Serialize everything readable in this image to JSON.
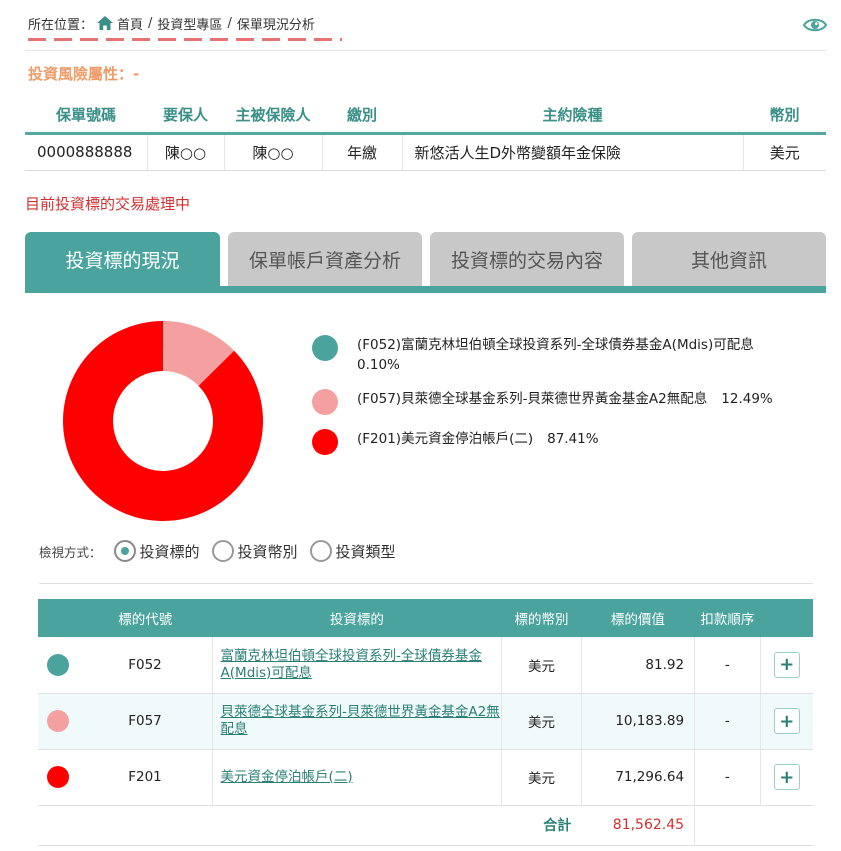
{
  "breadcrumb": {
    "location_label": "所在位置：",
    "items": [
      "首頁",
      "投資型專區",
      "保單現況分析"
    ],
    "separator": "/"
  },
  "risk": {
    "label": "投資風險屬性：-"
  },
  "policy_table": {
    "headers": [
      "保單號碼",
      "要保人",
      "主被保險人",
      "繳別",
      "主約險種",
      "幣別"
    ],
    "row": [
      "0000888888",
      "陳○○",
      "陳○○",
      "年繳",
      "新悠活人生D外幣變額年金保險",
      "美元"
    ]
  },
  "processing_notice": "目前投資標的交易處理中",
  "tabs": [
    {
      "label": "投資標的現況",
      "active": true
    },
    {
      "label": "保單帳戶資產分析",
      "active": false
    },
    {
      "label": "投資標的交易內容",
      "active": false
    },
    {
      "label": "其他資訊",
      "active": false
    }
  ],
  "chart_data": {
    "type": "pie",
    "categories": [
      "(F052)富蘭克林坦伯頓全球投資系列-全球債券基金A(Mdis)可配息",
      "(F057)貝萊德全球基金系列-貝萊德世界黃金基金A2無配息",
      "(F201)美元資金停泊帳戶(二)"
    ],
    "values": [
      0.1,
      12.49,
      87.41
    ],
    "percent_labels": [
      "0.10%",
      "12.49%",
      "87.41%"
    ],
    "colors": [
      "#4aa49d",
      "#f5a0a0",
      "#ff0000"
    ],
    "legend_position": "right"
  },
  "view_mode": {
    "label": "檢視方式：",
    "options": [
      "投資標的",
      "投資幣別",
      "投資類型"
    ],
    "selected": 0
  },
  "holdings": {
    "headers": [
      "",
      "標的代號",
      "投資標的",
      "標的幣別",
      "標的價值",
      "扣款順序",
      ""
    ],
    "rows": [
      {
        "color": "#4aa49d",
        "code": "F052",
        "name": "富蘭克林坦伯頓全球投資系列-全球債券基金A(Mdis)可配息",
        "currency": "美元",
        "value": "81.92",
        "order": "-"
      },
      {
        "color": "#f5a0a0",
        "code": "F057",
        "name": "貝萊德全球基金系列-貝萊德世界黃金基金A2無配息",
        "currency": "美元",
        "value": "10,183.89",
        "order": "-"
      },
      {
        "color": "#ff0000",
        "code": "F201",
        "name": "美元資金停泊帳戶(二)",
        "currency": "美元",
        "value": "71,296.64",
        "order": "-"
      }
    ],
    "plus_label": "+",
    "total_label": "合計",
    "total_value": "81,562.45"
  }
}
